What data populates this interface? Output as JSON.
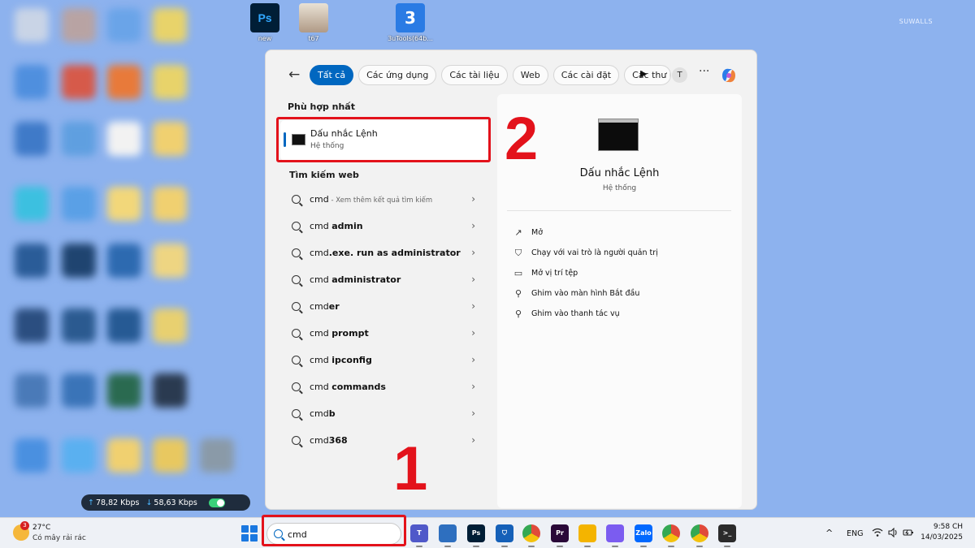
{
  "desktop": {
    "icons": [
      {
        "label": "new",
        "color": "#001e36",
        "glyph": "Ps"
      },
      {
        "label": "t67",
        "color": "#cfc0a8",
        "glyph": ""
      },
      {
        "label": "3uTools(64b...",
        "color": "#2a7be4",
        "glyph": "3"
      }
    ],
    "watermark": "SUWALLS",
    "network": {
      "up": "78,82 Kbps",
      "down": "58,63 Kbps",
      "up_glyph": "↑",
      "down_glyph": "↓"
    }
  },
  "search_panel": {
    "back_glyph": "←",
    "tabs": [
      "Tất cả",
      "Các ứng dụng",
      "Các tài liệu",
      "Web",
      "Các cài đặt",
      "Các thư m"
    ],
    "active_tab": 0,
    "more_glyph": "···",
    "avatar_letter": "T",
    "best_match_title": "Phù hợp nhất",
    "best_match": {
      "name": "Dấu nhắc Lệnh",
      "sub": "Hệ thống"
    },
    "web_title": "Tìm kiếm web",
    "web_results": [
      {
        "query": "cmd",
        "bold": "",
        "hint": " - Xem thêm kết quả tìm kiếm"
      },
      {
        "query": "cmd ",
        "bold": "admin",
        "hint": ""
      },
      {
        "query": "cmd",
        "bold": ".exe. run as administrator",
        "hint": ""
      },
      {
        "query": "cmd ",
        "bold": "administrator",
        "hint": ""
      },
      {
        "query": "cmd",
        "bold": "er",
        "hint": ""
      },
      {
        "query": "cmd ",
        "bold": "prompt",
        "hint": ""
      },
      {
        "query": "cmd ",
        "bold": "ipconfig",
        "hint": ""
      },
      {
        "query": "cmd ",
        "bold": "commands",
        "hint": ""
      },
      {
        "query": "cmd",
        "bold": "b",
        "hint": ""
      },
      {
        "query": "cmd",
        "bold": "368",
        "hint": ""
      }
    ],
    "chevron_glyph": "›",
    "detail": {
      "title": "Dấu nhắc Lệnh",
      "sub": "Hệ thống",
      "actions": [
        {
          "label": "Mở",
          "icon": "open-icon",
          "glyph": "↗"
        },
        {
          "label": "Chạy với vai trò là người quản trị",
          "icon": "shield-icon",
          "glyph": "⛉"
        },
        {
          "label": "Mở vị trí tệp",
          "icon": "folder-icon",
          "glyph": "▭"
        },
        {
          "label": "Ghim vào màn hình Bắt đầu",
          "icon": "pin-icon",
          "glyph": "⚲"
        },
        {
          "label": "Ghim vào thanh tác vụ",
          "icon": "pin-icon",
          "glyph": "⚲"
        }
      ]
    }
  },
  "annotations": {
    "step1": "1",
    "step2": "2",
    "color": "#e3121b"
  },
  "taskbar": {
    "weather": {
      "temp": "27°C",
      "desc": "Có mây rải rác",
      "badge": "3"
    },
    "search_value": "cmd",
    "apps": [
      {
        "name": "teams-icon",
        "color": "#5059c9",
        "glyph": "T"
      },
      {
        "name": "network-app-icon",
        "color": "#2e6fbf",
        "glyph": ""
      },
      {
        "name": "photoshop-icon",
        "color": "#001e36",
        "glyph": "Ps"
      },
      {
        "name": "defender-icon",
        "color": "#1560b8",
        "glyph": "⛉"
      },
      {
        "name": "chrome-icon",
        "color": "#e04a3a",
        "glyph": ""
      },
      {
        "name": "premiere-icon",
        "color": "#2a0838",
        "glyph": "Pr"
      },
      {
        "name": "file-explorer-icon",
        "color": "#f4b400",
        "glyph": ""
      },
      {
        "name": "copilot-icon",
        "color": "#7b5cf0",
        "glyph": ""
      },
      {
        "name": "zalo-icon",
        "color": "#0068ff",
        "glyph": "Zalo"
      },
      {
        "name": "chrome-profile-icon",
        "color": "#34a853",
        "glyph": ""
      },
      {
        "name": "chrome-profile2-icon",
        "color": "#e04a3a",
        "glyph": ""
      },
      {
        "name": "terminal-icon",
        "color": "#2b2b2b",
        "glyph": ">_"
      }
    ],
    "tray": {
      "caret": "^",
      "lang": "ENG"
    },
    "clock": {
      "time": "9:58 CH",
      "date": "14/03/2025"
    }
  },
  "colors": {
    "accent": "#0067c0",
    "highlight": "#e3121b",
    "desktop": "#8db2ee"
  }
}
